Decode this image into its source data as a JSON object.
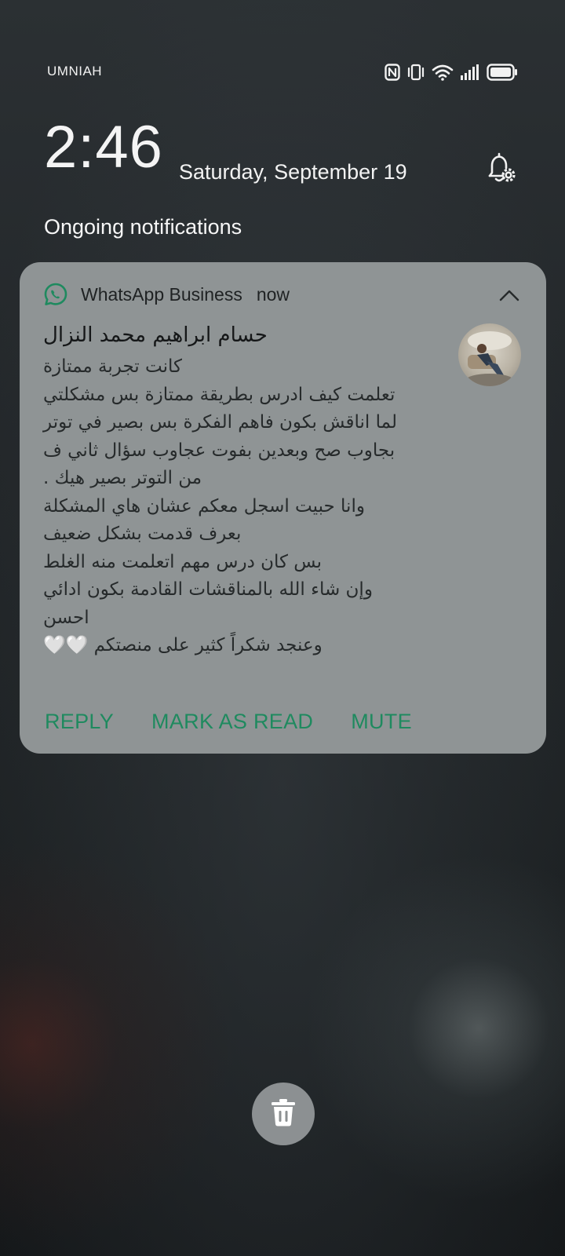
{
  "status_bar": {
    "carrier": "UMNIAH",
    "icons": [
      "nfc-icon",
      "vibrate-icon",
      "wifi-icon",
      "signal-icon",
      "battery-icon"
    ]
  },
  "header": {
    "time": "2:46",
    "date": "Saturday, September 19",
    "notification_settings_icon": "bell-settings-icon"
  },
  "section_title": "Ongoing notifications",
  "notification": {
    "app_name": "WhatsApp Business",
    "time": "now",
    "app_color": "#25D366",
    "sender": "حسام ابراهيم محمد النزال",
    "message_lines": [
      "كانت تجربة ممتازة",
      "تعلمت كيف ادرس  بطريقة ممتازة  بس مشكلتي",
      "لما اناقش بكون فاهم الفكرة  بس بصير في توتر",
      "بجاوب صح وبعدين بفوت عجاوب سؤال ثاني ف",
      "من التوتر  بصير هيك .",
      "وانا حبيت اسجل معكم عشان هاي المشكلة",
      "بعرف قدمت بشكل ضعيف",
      "بس كان درس  مهم اتعلمت منه الغلط",
      "وإن شاء الله بالمناقشات القادمة بكون ادائي",
      "احسن",
      "وعنجد شكراً كثير  على منصتكم 🤍🤍"
    ],
    "actions": {
      "reply": "REPLY",
      "mark_as_read": "MARK AS READ",
      "mute": "MUTE"
    },
    "action_color": "#1F8A5F"
  },
  "clear_all_icon": "trash-icon"
}
